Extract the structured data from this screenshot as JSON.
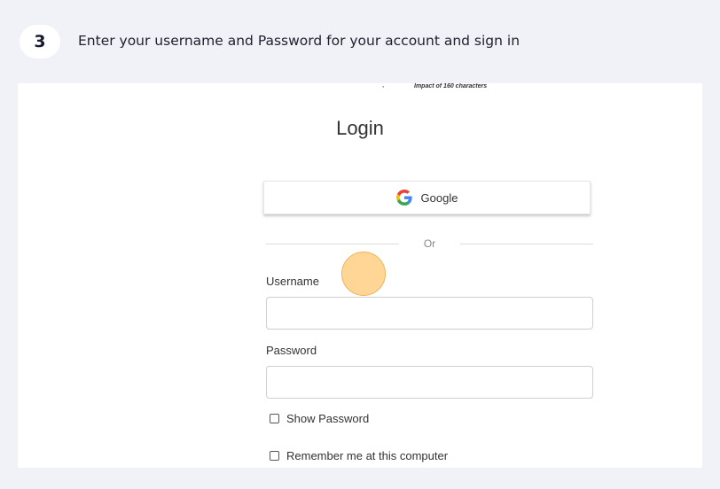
{
  "step": {
    "number": "3",
    "instruction": "Enter your username and Password for your account and sign in"
  },
  "screenshot": {
    "tagline": "Impact of 160 characters",
    "tick": ",",
    "title": "Login",
    "google_button": {
      "label": "Google",
      "icon": "google-g-icon"
    },
    "divider_text": "Or",
    "username": {
      "label": "Username",
      "value": "",
      "placeholder": ""
    },
    "password": {
      "label": "Password",
      "value": "",
      "placeholder": ""
    },
    "show_password": {
      "label": "Show Password",
      "checked": false
    },
    "remember_me": {
      "label": "Remember me at this computer",
      "checked": false
    }
  },
  "colors": {
    "page_background": "#f1f2f7",
    "click_highlight": "#ffc66e",
    "google_blue": "#4285F4",
    "google_red": "#EA4335",
    "google_yellow": "#FBBC05",
    "google_green": "#34A853"
  }
}
